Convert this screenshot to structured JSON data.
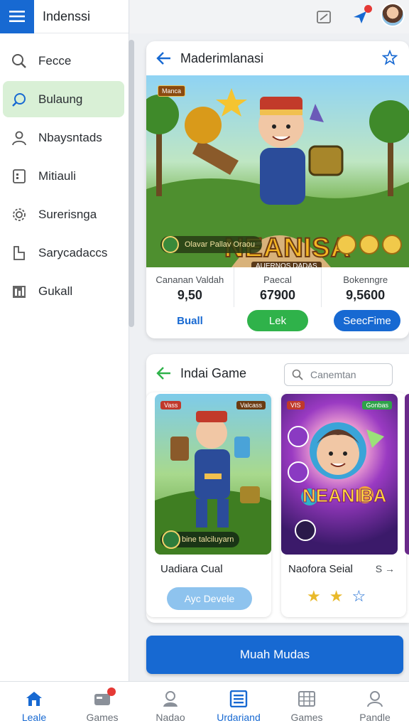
{
  "app": {
    "title": "Indenssi"
  },
  "sidebar": {
    "items": [
      {
        "label": "Fecce",
        "icon": "search-icon"
      },
      {
        "label": "Bulaung",
        "icon": "search-icon",
        "active": true
      },
      {
        "label": "Nbaysntads",
        "icon": "user-icon"
      },
      {
        "label": "Mitiauli",
        "icon": "document-icon"
      },
      {
        "label": "Surerisnga",
        "icon": "gear-icon"
      },
      {
        "label": "Sarycadaccs",
        "icon": "file-icon"
      },
      {
        "label": "Gukall",
        "icon": "chart-icon"
      }
    ]
  },
  "featured": {
    "title": "Maderimlanasi",
    "hero": {
      "badge": "Manca",
      "logo": "NEANISA",
      "subtitle": "AUERNOS DADAS",
      "pill": "Olavar Pallav Oraou"
    },
    "stats": [
      {
        "label": "Cananan Valdah",
        "value": "9,50"
      },
      {
        "label": "Paecal",
        "value": "67900"
      },
      {
        "label": "Bokenngre",
        "value": "9,5600"
      }
    ],
    "actions": {
      "link": "Buall",
      "green": "Lek",
      "blue": "SeecFime"
    }
  },
  "games_section": {
    "title": "Indai Game",
    "search_placeholder": "Canemtan",
    "games": [
      {
        "name": "Uadiara Cual",
        "tag_left": "Vass",
        "tag_right": "Valcass",
        "pill": "bine talciluyarn",
        "button": "Ayc Devele"
      },
      {
        "name": "Naofora Seial",
        "price": "S →",
        "tag_left": "VIS",
        "tag_right": "Gonbas",
        "logo": "NEANIBA",
        "rating": 2,
        "rating_max": 3
      }
    ]
  },
  "primary_button": "Muah Mudas",
  "bottom_nav": [
    {
      "label": "Leale",
      "icon": "home-icon",
      "active": true
    },
    {
      "label": "Games",
      "icon": "games-icon",
      "badge": true
    },
    {
      "label": "Nadao",
      "icon": "user-icon"
    },
    {
      "label": "Urdariand",
      "icon": "list-icon",
      "active": true
    },
    {
      "label": "Games",
      "icon": "grid-icon"
    },
    {
      "label": "Pandle",
      "icon": "profile-icon"
    }
  ],
  "colors": {
    "accent": "#1769d2",
    "green": "#2fb24a",
    "active_bg": "#d9f0d6",
    "badge_red": "#e53935"
  }
}
